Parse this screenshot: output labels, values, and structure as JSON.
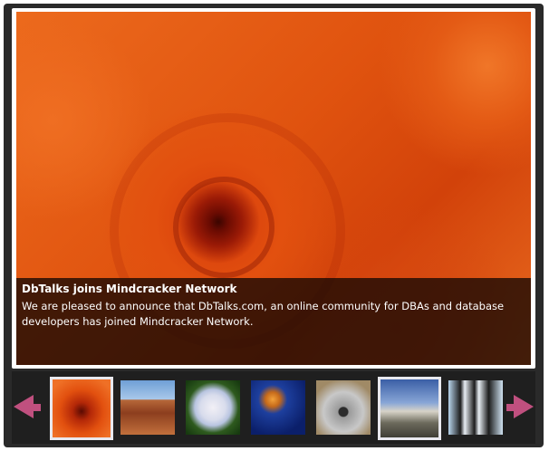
{
  "slide": {
    "title": "DbTalks joins Mindcracker Network",
    "description": "We are pleased to announce that DbTalks.com, an online community for DBAs and database developers has joined Mindcracker Network.",
    "image": "chrysanthemum-photo"
  },
  "thumbnails": [
    {
      "name": "chrysanthemum-thumbnail",
      "selected": true
    },
    {
      "name": "desert-thumbnail",
      "selected": false
    },
    {
      "name": "hydrangeas-thumbnail",
      "selected": false
    },
    {
      "name": "jellyfish-thumbnail",
      "selected": false
    },
    {
      "name": "koala-thumbnail",
      "selected": false
    },
    {
      "name": "lighthouse-thumbnail",
      "selected": true
    },
    {
      "name": "penguins-thumbnail",
      "selected": false
    }
  ],
  "navigation": {
    "prev_icon": "arrow-left-icon",
    "next_icon": "arrow-right-icon",
    "accent_color": "#c0507f"
  }
}
